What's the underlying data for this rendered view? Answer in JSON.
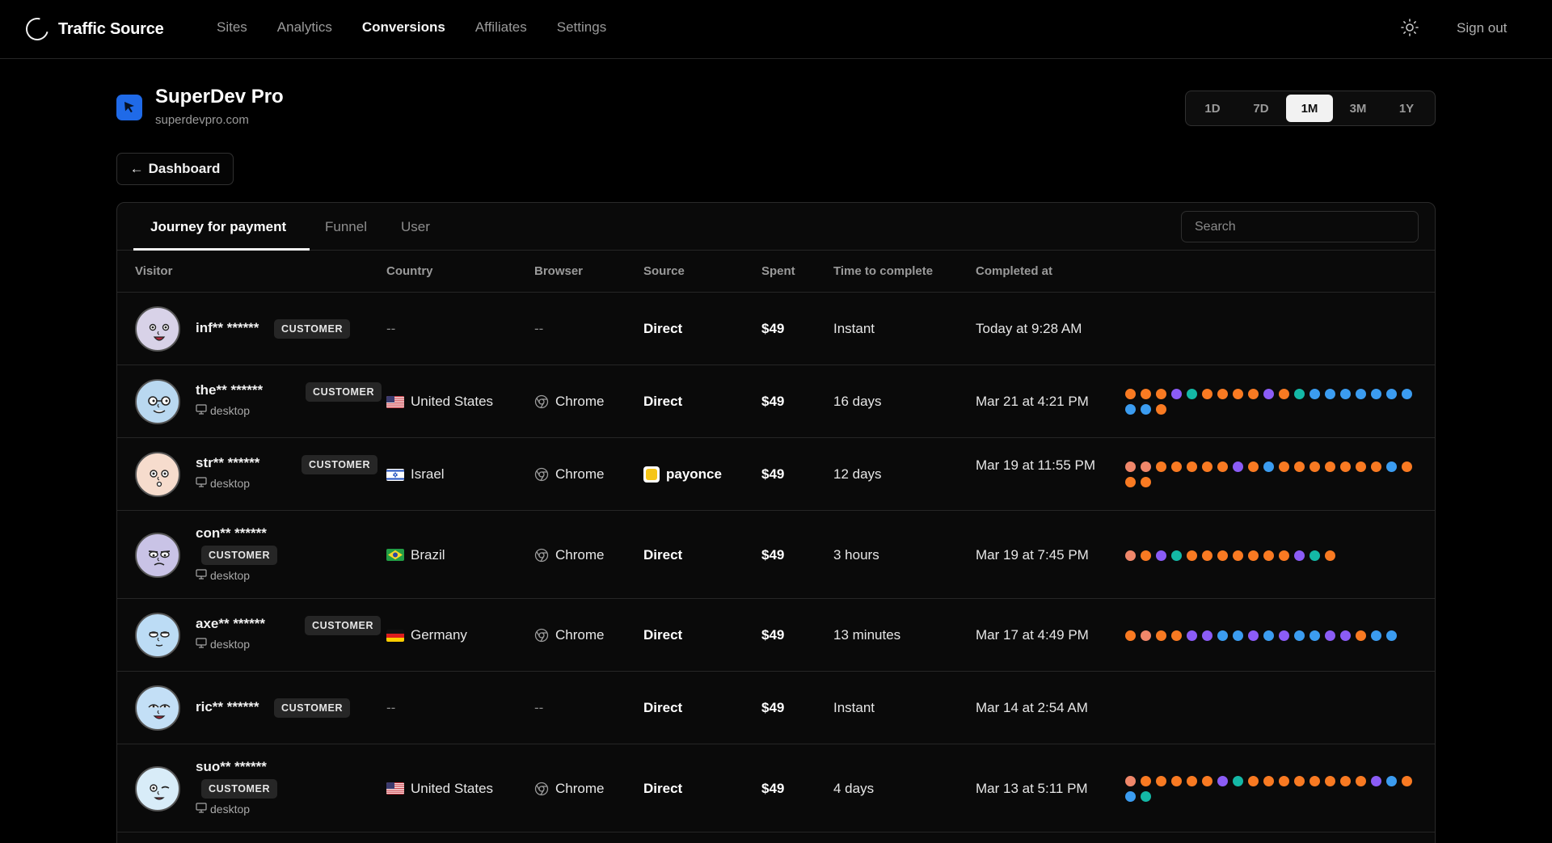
{
  "brand": {
    "name": "Traffic Source"
  },
  "nav": [
    {
      "label": "Sites",
      "active": false
    },
    {
      "label": "Analytics",
      "active": false
    },
    {
      "label": "Conversions",
      "active": true
    },
    {
      "label": "Affiliates",
      "active": false
    },
    {
      "label": "Settings",
      "active": false
    }
  ],
  "header": {
    "signout": "Sign out"
  },
  "site": {
    "title": "SuperDev Pro",
    "domain": "superdevpro.com"
  },
  "ranges": [
    {
      "label": "1D",
      "active": false
    },
    {
      "label": "7D",
      "active": false
    },
    {
      "label": "1M",
      "active": true
    },
    {
      "label": "3M",
      "active": false
    },
    {
      "label": "1Y",
      "active": false
    }
  ],
  "back_label": "Dashboard",
  "tabs": [
    {
      "label": "Journey for payment",
      "active": true
    },
    {
      "label": "Funnel",
      "active": false
    },
    {
      "label": "User",
      "active": false
    }
  ],
  "search": {
    "placeholder": "Search"
  },
  "columns": {
    "visitor": "Visitor",
    "country": "Country",
    "browser": "Browser",
    "source": "Source",
    "spent": "Spent",
    "time": "Time to complete",
    "completed": "Completed at"
  },
  "colors": {
    "salmon": "#f0876a",
    "orange": "#f97a22",
    "purple": "#8b5cf6",
    "teal": "#14b8a6",
    "blue": "#3b9cf0",
    "accent": "#1f6ae8"
  },
  "rows": [
    {
      "name": "inf** ******",
      "badge": "CUSTOMER",
      "device": "",
      "country": "--",
      "flag": "",
      "browser": "--",
      "source": "Direct",
      "source_icon": "",
      "spent": "$49",
      "time": "Instant",
      "completed": "Today at 9:28 AM",
      "journey": []
    },
    {
      "name": "the** ******",
      "badge": "CUSTOMER",
      "device": "desktop",
      "country": "United States",
      "flag": "us",
      "browser": "Chrome",
      "source": "Direct",
      "source_icon": "",
      "spent": "$49",
      "time": "16 days",
      "completed": "Mar 21 at 4:21 PM",
      "journey": [
        "orange",
        "orange",
        "orange",
        "purple",
        "teal",
        "orange",
        "orange",
        "orange",
        "orange",
        "purple",
        "orange",
        "teal",
        "blue",
        "blue",
        "blue",
        "blue",
        "blue",
        "blue",
        "blue",
        "blue",
        "blue",
        "orange"
      ]
    },
    {
      "name": "str** ******",
      "badge": "CUSTOMER",
      "device": "desktop",
      "country": "Israel",
      "flag": "il",
      "browser": "Chrome",
      "source": "payonce",
      "source_icon": "payonce",
      "spent": "$49",
      "time": "12 days",
      "completed": "Mar 19 at 11:55 PM",
      "journey": [
        "salmon",
        "salmon",
        "orange",
        "orange",
        "orange",
        "orange",
        "orange",
        "purple",
        "orange",
        "blue",
        "orange",
        "orange",
        "orange",
        "orange",
        "orange",
        "orange",
        "orange",
        "blue",
        "orange",
        "orange",
        "orange"
      ]
    },
    {
      "name": "con** ******",
      "badge": "CUSTOMER",
      "device": "desktop",
      "country": "Brazil",
      "flag": "br",
      "browser": "Chrome",
      "source": "Direct",
      "source_icon": "",
      "spent": "$49",
      "time": "3 hours",
      "completed": "Mar 19 at 7:45 PM",
      "journey": [
        "salmon",
        "orange",
        "purple",
        "teal",
        "orange",
        "orange",
        "orange",
        "orange",
        "orange",
        "orange",
        "orange",
        "purple",
        "teal",
        "orange"
      ]
    },
    {
      "name": "axe** ******",
      "badge": "CUSTOMER",
      "device": "desktop",
      "country": "Germany",
      "flag": "de",
      "browser": "Chrome",
      "source": "Direct",
      "source_icon": "",
      "spent": "$49",
      "time": "13 minutes",
      "completed": "Mar 17 at 4:49 PM",
      "journey": [
        "orange",
        "salmon",
        "orange",
        "orange",
        "purple",
        "purple",
        "blue",
        "blue",
        "purple",
        "blue",
        "purple",
        "blue",
        "blue",
        "purple",
        "purple",
        "orange",
        "blue",
        "blue"
      ]
    },
    {
      "name": "ric** ******",
      "badge": "CUSTOMER",
      "device": "",
      "country": "--",
      "flag": "",
      "browser": "--",
      "source": "Direct",
      "source_icon": "",
      "spent": "$49",
      "time": "Instant",
      "completed": "Mar 14 at 2:54 AM",
      "journey": []
    },
    {
      "name": "suo** ******",
      "badge": "CUSTOMER",
      "device": "desktop",
      "country": "United States",
      "flag": "us",
      "browser": "Chrome",
      "source": "Direct",
      "source_icon": "",
      "spent": "$49",
      "time": "4 days",
      "completed": "Mar 13 at 5:11 PM",
      "journey": [
        "salmon",
        "orange",
        "orange",
        "orange",
        "orange",
        "orange",
        "purple",
        "teal",
        "orange",
        "orange",
        "orange",
        "orange",
        "orange",
        "orange",
        "orange",
        "orange",
        "purple",
        "blue",
        "orange",
        "blue",
        "teal"
      ]
    }
  ]
}
